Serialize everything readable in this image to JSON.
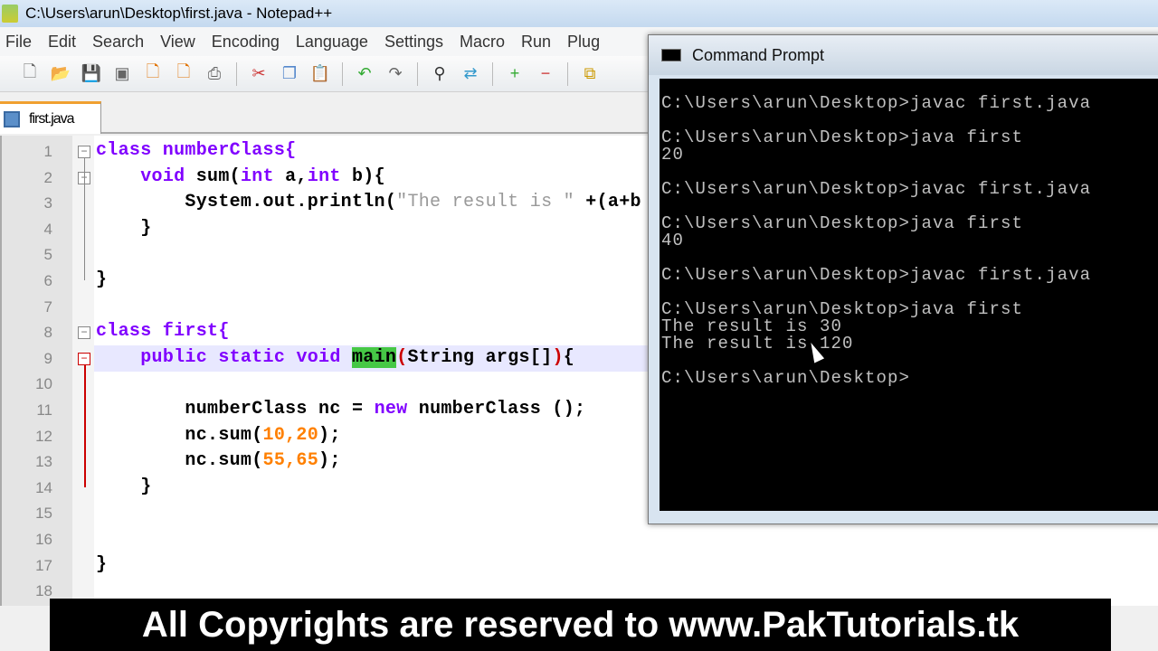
{
  "window": {
    "title": "C:\\Users\\arun\\Desktop\\first.java - Notepad++"
  },
  "menu": [
    "File",
    "Edit",
    "Search",
    "View",
    "Encoding",
    "Language",
    "Settings",
    "Macro",
    "Run",
    "Plug"
  ],
  "toolbar": [
    "new-file-icon",
    "open-icon",
    "save-icon",
    "save-all-icon",
    "close-icon",
    "close-all-icon",
    "print-icon",
    "cut-icon",
    "copy-icon",
    "paste-icon",
    "undo-icon",
    "redo-icon",
    "find-icon",
    "replace-icon",
    "zoom-in-icon",
    "zoom-out-icon",
    "sync-icon"
  ],
  "tab": {
    "label": "first.java"
  },
  "code": {
    "l1": "class numberClass{",
    "l2a": "    ",
    "l2k1": "void",
    " l2b": "",
    "l2c": " sum(",
    "l2k2": "int",
    "l2d": " a,",
    "l2k3": "int",
    "l2e": " b){",
    "l3a": "        System.out.println(",
    "l3s": "\"The result is \"",
    "l3b": " +(a+b",
    "l4": "    }",
    "l6": "}",
    "l8": "class first{",
    "l9k": "public static void",
    "l9m": "main",
    "l9p1": "(",
    "l9b": "String args[]",
    "l9p2": ")",
    "l9c": "{",
    "l11a": "        numberClass nc = ",
    "l11k": "new",
    "l11b": " numberClass ();",
    "l12a": "        nc.sum(",
    "l12n": "10,20",
    "l12b": ");",
    "l13a": "        nc.sum(",
    "l13n": "55,65",
    "l13b": ");",
    "l14": "    }",
    "l17": "}"
  },
  "line_numbers": [
    "1",
    "2",
    "3",
    "4",
    "5",
    "6",
    "7",
    "8",
    "9",
    "10",
    "11",
    "12",
    "13",
    "14",
    "15",
    "16",
    "17",
    "18"
  ],
  "cmd": {
    "title": "Command Prompt",
    "lines": [
      "C:\\Users\\arun\\Desktop>javac first.java",
      "",
      "C:\\Users\\arun\\Desktop>java first",
      "20",
      "",
      "C:\\Users\\arun\\Desktop>javac first.java",
      "",
      "C:\\Users\\arun\\Desktop>java first",
      "40",
      "",
      "C:\\Users\\arun\\Desktop>javac first.java",
      "",
      "C:\\Users\\arun\\Desktop>java first",
      "The result is 30",
      "The result is 120",
      "",
      "C:\\Users\\arun\\Desktop>"
    ]
  },
  "banner": "All Copyrights are reserved to www.PakTutorials.tk"
}
